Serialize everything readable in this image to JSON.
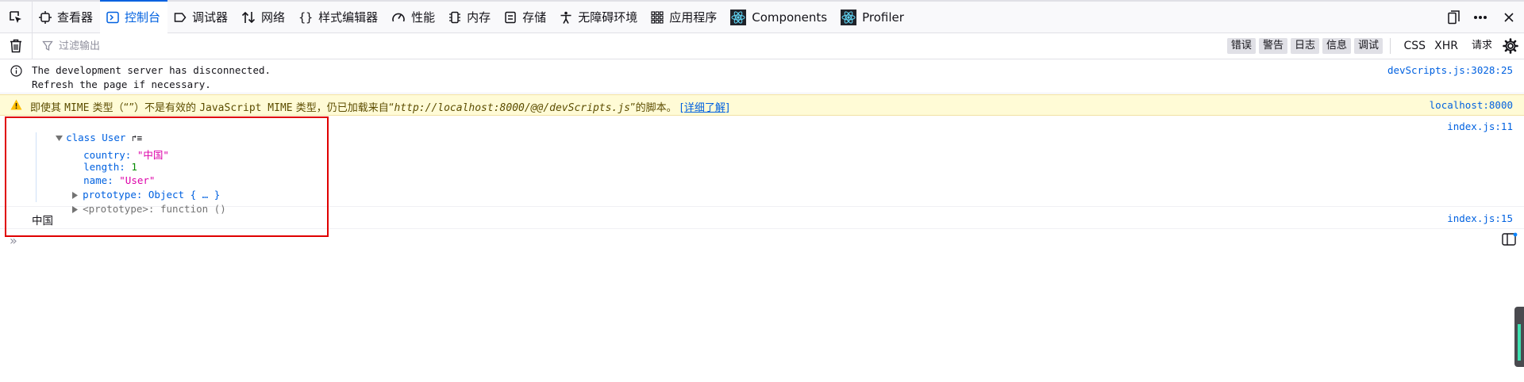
{
  "toolbar": {
    "tabs": [
      {
        "label": "查看器",
        "icon": "inspector-icon"
      },
      {
        "label": "控制台",
        "icon": "console-icon"
      },
      {
        "label": "调试器",
        "icon": "debugger-icon"
      },
      {
        "label": "网络",
        "icon": "network-icon"
      },
      {
        "label": "样式编辑器",
        "icon": "style-editor-icon"
      },
      {
        "label": "性能",
        "icon": "performance-icon"
      },
      {
        "label": "内存",
        "icon": "memory-icon"
      },
      {
        "label": "存储",
        "icon": "storage-icon"
      },
      {
        "label": "无障碍环境",
        "icon": "accessibility-icon"
      },
      {
        "label": "应用程序",
        "icon": "application-icon"
      },
      {
        "label": "Components",
        "icon": "react-icon"
      },
      {
        "label": "Profiler",
        "icon": "react-icon"
      }
    ],
    "selected_tab": "控制台"
  },
  "filterbar": {
    "placeholder": "过滤输出",
    "levels": [
      "错误",
      "警告",
      "日志",
      "信息",
      "调试"
    ],
    "requests": [
      "CSS",
      "XHR",
      "请求"
    ]
  },
  "messages": {
    "disconnect": {
      "line1": "The development server has disconnected.",
      "line2": "Refresh the page if necessary.",
      "source": "devScripts.js:3028:25"
    },
    "warning": {
      "prefix": "即使其 ",
      "mime": "MIME",
      "part2": " 类型（“”）不是有效的 ",
      "js_mime": "JavaScript MIME",
      "part3": " 类型，仍已加载来自“",
      "url": "http://localhost:8000/@@/devScripts.js",
      "part4": "”的脚本。",
      "link": "[详细了解]",
      "source": "localhost:8000"
    },
    "class_log": {
      "header_kw": "class",
      "header_name": "User",
      "header_suffix": "↱≡",
      "props": {
        "country_key": "country:",
        "country_val": "\"中国\"",
        "length_key": "length:",
        "length_val": "1",
        "name_key": "name:",
        "name_val": "\"User\"",
        "prototype_key": "prototype:",
        "prototype_val": "Object { … }",
        "proto_key": "<prototype>:",
        "proto_val": "function ()"
      },
      "source": "index.js:11"
    },
    "string_log": {
      "text": "中国",
      "source": "index.js:15"
    }
  },
  "input": {
    "prompt": "»"
  },
  "colors": {
    "accent": "#0061e0",
    "string": "#dd00a9",
    "number": "#058b00",
    "warning_bg": "#fffbd6",
    "highlight": "#e00000"
  }
}
